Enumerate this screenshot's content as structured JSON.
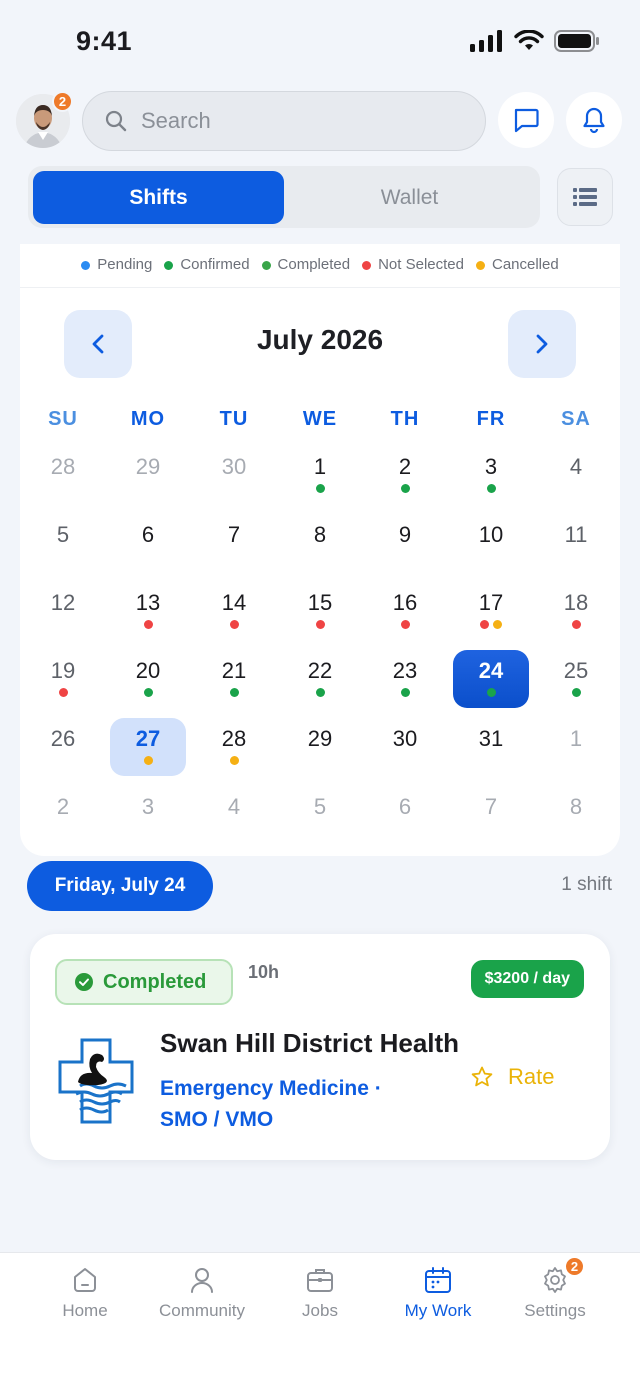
{
  "status_bar": {
    "time": "9:41"
  },
  "header": {
    "avatar_badge": "2",
    "search_placeholder": "Search"
  },
  "tabs": [
    {
      "label": "Shifts",
      "active": true
    },
    {
      "label": "Wallet",
      "active": false
    }
  ],
  "legend": [
    {
      "label": "Pending",
      "color": "#2a8bf2"
    },
    {
      "label": "Confirmed",
      "color": "#1aa34a"
    },
    {
      "label": "Completed",
      "color": "#3aa54a"
    },
    {
      "label": "Not Selected",
      "color": "#ef4444"
    },
    {
      "label": "Cancelled",
      "color": "#f5b014"
    }
  ],
  "calendar": {
    "title": "July 2026",
    "weekdays": [
      "SU",
      "MO",
      "TU",
      "WE",
      "TH",
      "FR",
      "SA"
    ],
    "weeks": [
      [
        {
          "n": "28",
          "muted": true
        },
        {
          "n": "29",
          "muted": true
        },
        {
          "n": "30",
          "muted": true
        },
        {
          "n": "1",
          "dots": [
            "#1aa34a"
          ]
        },
        {
          "n": "2",
          "dots": [
            "#1aa34a"
          ]
        },
        {
          "n": "3",
          "dots": [
            "#1aa34a"
          ]
        },
        {
          "n": "4"
        }
      ],
      [
        {
          "n": "5"
        },
        {
          "n": "6"
        },
        {
          "n": "7"
        },
        {
          "n": "8"
        },
        {
          "n": "9"
        },
        {
          "n": "10"
        },
        {
          "n": "11"
        }
      ],
      [
        {
          "n": "12"
        },
        {
          "n": "13",
          "dots": [
            "#ef4444"
          ]
        },
        {
          "n": "14",
          "dots": [
            "#ef4444"
          ]
        },
        {
          "n": "15",
          "dots": [
            "#ef4444"
          ]
        },
        {
          "n": "16",
          "dots": [
            "#ef4444"
          ]
        },
        {
          "n": "17",
          "dots": [
            "#ef4444",
            "#f5b014"
          ]
        },
        {
          "n": "18",
          "dots": [
            "#ef4444"
          ]
        }
      ],
      [
        {
          "n": "19",
          "dots": [
            "#ef4444"
          ]
        },
        {
          "n": "20",
          "dots": [
            "#1aa34a"
          ]
        },
        {
          "n": "21",
          "dots": [
            "#1aa34a"
          ]
        },
        {
          "n": "22",
          "dots": [
            "#1aa34a"
          ]
        },
        {
          "n": "23",
          "dots": [
            "#1aa34a"
          ]
        },
        {
          "n": "24",
          "dots": [
            "#1aa34a"
          ],
          "selected": true
        },
        {
          "n": "25",
          "dots": [
            "#1aa34a"
          ]
        }
      ],
      [
        {
          "n": "26"
        },
        {
          "n": "27",
          "dots": [
            "#f5b014"
          ],
          "today": true
        },
        {
          "n": "28",
          "dots": [
            "#f5b014"
          ]
        },
        {
          "n": "29"
        },
        {
          "n": "30"
        },
        {
          "n": "31"
        },
        {
          "n": "1",
          "muted": true
        }
      ],
      [
        {
          "n": "2",
          "muted": true
        },
        {
          "n": "3",
          "muted": true
        },
        {
          "n": "4",
          "muted": true
        },
        {
          "n": "5",
          "muted": true
        },
        {
          "n": "6",
          "muted": true
        },
        {
          "n": "7",
          "muted": true
        },
        {
          "n": "8",
          "muted": true
        }
      ]
    ]
  },
  "selected_day": {
    "label": "Friday, July 24",
    "count": "1 shift"
  },
  "shift": {
    "status": "Completed",
    "hours": "10h",
    "price": "$3200 / day",
    "hospital": "Swan Hill District Health",
    "specialty": "Emergency Medicine · SMO / VMO",
    "rate_label": "Rate"
  },
  "bottom_nav": {
    "items": [
      {
        "label": "Home",
        "icon": "home-icon"
      },
      {
        "label": "Community",
        "icon": "person-icon"
      },
      {
        "label": "Jobs",
        "icon": "briefcase-icon"
      },
      {
        "label": "My Work",
        "icon": "calendar-icon",
        "active": true
      },
      {
        "label": "Settings",
        "icon": "gear-icon"
      }
    ],
    "settings_badge": "2"
  }
}
